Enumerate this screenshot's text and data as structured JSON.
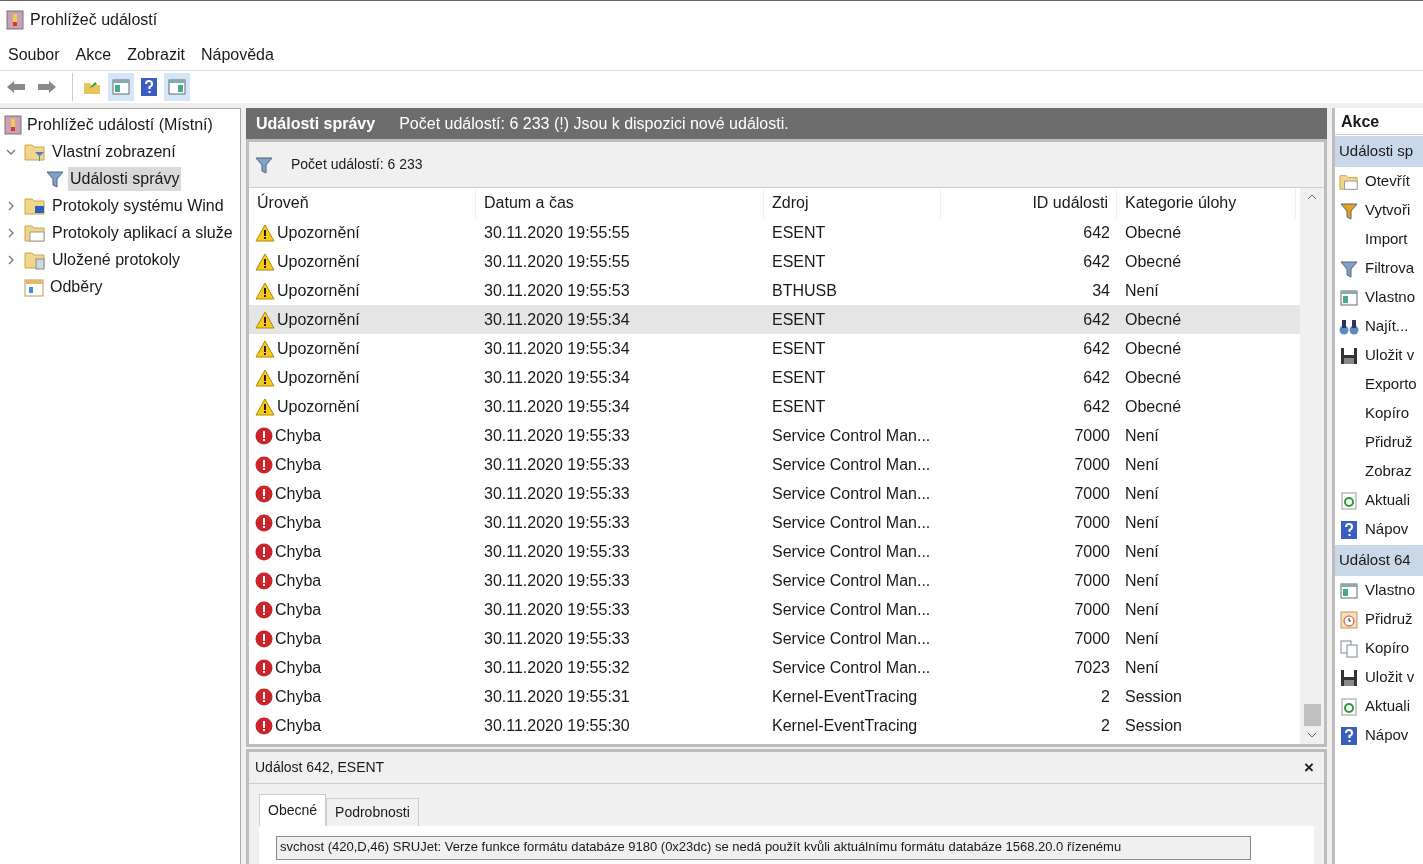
{
  "window": {
    "title": "Prohlížeč událostí"
  },
  "menu": [
    "Soubor",
    "Akce",
    "Zobrazit",
    "Nápověda"
  ],
  "toolbar": [
    {
      "kind": "back",
      "selected": false
    },
    {
      "kind": "forward",
      "selected": false
    },
    {
      "kind": "folder-up",
      "selected": false
    },
    {
      "kind": "pane-left",
      "selected": true
    },
    {
      "kind": "help",
      "selected": false
    },
    {
      "kind": "pane-right",
      "selected": true
    }
  ],
  "tree": [
    {
      "label": "Prohlížeč událostí (Místní)",
      "selected": false,
      "children": [
        {
          "label": "Vlastní zobrazení",
          "expanded": true,
          "selected": false,
          "children": [
            {
              "label": "Události správy",
              "selected": true
            }
          ]
        },
        {
          "label": "Protokoly systému Wind",
          "expanded": false,
          "selected": false
        },
        {
          "label": "Protokoly aplikací a služe",
          "expanded": false,
          "selected": false
        },
        {
          "label": "Uložené protokoly",
          "expanded": false,
          "selected": false
        },
        {
          "label": "Odběry",
          "selected": false
        }
      ]
    }
  ],
  "header": {
    "title": "Události správy",
    "message": "Počet událostí: 6 233 (!) Jsou k dispozici nové události."
  },
  "filter_bar": "Počet událostí: 6 233",
  "table": {
    "columns": [
      "Úroveň",
      "Datum a čas",
      "Zdroj",
      "ID události",
      "Kategorie úlohy"
    ],
    "rows": [
      {
        "kind": "warning",
        "level": "Upozornění",
        "date": "30.11.2020 19:55:55",
        "source": "ESENT",
        "id": "642",
        "category": "Obecné",
        "selected": false
      },
      {
        "kind": "warning",
        "level": "Upozornění",
        "date": "30.11.2020 19:55:55",
        "source": "ESENT",
        "id": "642",
        "category": "Obecné",
        "selected": false
      },
      {
        "kind": "warning",
        "level": "Upozornění",
        "date": "30.11.2020 19:55:53",
        "source": "BTHUSB",
        "id": "34",
        "category": "Není",
        "selected": false
      },
      {
        "kind": "warning",
        "level": "Upozornění",
        "date": "30.11.2020 19:55:34",
        "source": "ESENT",
        "id": "642",
        "category": "Obecné",
        "selected": true
      },
      {
        "kind": "warning",
        "level": "Upozornění",
        "date": "30.11.2020 19:55:34",
        "source": "ESENT",
        "id": "642",
        "category": "Obecné",
        "selected": false
      },
      {
        "kind": "warning",
        "level": "Upozornění",
        "date": "30.11.2020 19:55:34",
        "source": "ESENT",
        "id": "642",
        "category": "Obecné",
        "selected": false
      },
      {
        "kind": "warning",
        "level": "Upozornění",
        "date": "30.11.2020 19:55:34",
        "source": "ESENT",
        "id": "642",
        "category": "Obecné",
        "selected": false
      },
      {
        "kind": "error",
        "level": "Chyba",
        "date": "30.11.2020 19:55:33",
        "source": "Service Control Man...",
        "id": "7000",
        "category": "Není",
        "selected": false
      },
      {
        "kind": "error",
        "level": "Chyba",
        "date": "30.11.2020 19:55:33",
        "source": "Service Control Man...",
        "id": "7000",
        "category": "Není",
        "selected": false
      },
      {
        "kind": "error",
        "level": "Chyba",
        "date": "30.11.2020 19:55:33",
        "source": "Service Control Man...",
        "id": "7000",
        "category": "Není",
        "selected": false
      },
      {
        "kind": "error",
        "level": "Chyba",
        "date": "30.11.2020 19:55:33",
        "source": "Service Control Man...",
        "id": "7000",
        "category": "Není",
        "selected": false
      },
      {
        "kind": "error",
        "level": "Chyba",
        "date": "30.11.2020 19:55:33",
        "source": "Service Control Man...",
        "id": "7000",
        "category": "Není",
        "selected": false
      },
      {
        "kind": "error",
        "level": "Chyba",
        "date": "30.11.2020 19:55:33",
        "source": "Service Control Man...",
        "id": "7000",
        "category": "Není",
        "selected": false
      },
      {
        "kind": "error",
        "level": "Chyba",
        "date": "30.11.2020 19:55:33",
        "source": "Service Control Man...",
        "id": "7000",
        "category": "Není",
        "selected": false
      },
      {
        "kind": "error",
        "level": "Chyba",
        "date": "30.11.2020 19:55:33",
        "source": "Service Control Man...",
        "id": "7000",
        "category": "Není",
        "selected": false
      },
      {
        "kind": "error",
        "level": "Chyba",
        "date": "30.11.2020 19:55:32",
        "source": "Service Control Man...",
        "id": "7023",
        "category": "Není",
        "selected": false
      },
      {
        "kind": "error",
        "level": "Chyba",
        "date": "30.11.2020 19:55:31",
        "source": "Kernel-EventTracing",
        "id": "2",
        "category": "Session",
        "selected": false
      },
      {
        "kind": "error",
        "level": "Chyba",
        "date": "30.11.2020 19:55:30",
        "source": "Kernel-EventTracing",
        "id": "2",
        "category": "Session",
        "selected": false
      }
    ]
  },
  "detail": {
    "title": "Událost 642, ESENT",
    "close": "×",
    "tabs": [
      {
        "label": "Obecné",
        "selected": true
      },
      {
        "label": "Podrobnosti",
        "selected": false
      }
    ],
    "text": "svchost (420,D,46) SRUJet: Verze funkce formátu databáze 9180 (0x23dc) se nedá použít kvůli aktuálnímu formátu databáze 1568.20.0 řízenému"
  },
  "actions": {
    "title": "Akce",
    "sections": [
      {
        "title": "Události sp",
        "items": [
          "Otevřít",
          "Vytvoři",
          "Import",
          "Filtrova",
          "Vlastno",
          "Najít...",
          "Uložit v",
          "Exporto",
          "Kopíro",
          "Přidruž",
          "Zobraz",
          "Aktuali",
          "Nápov"
        ]
      },
      {
        "title": "Událost 64",
        "items": [
          "Vlastno",
          "Přidruž",
          "Kopíro",
          "Uložit v",
          "Aktuali",
          "Nápov"
        ]
      }
    ]
  }
}
